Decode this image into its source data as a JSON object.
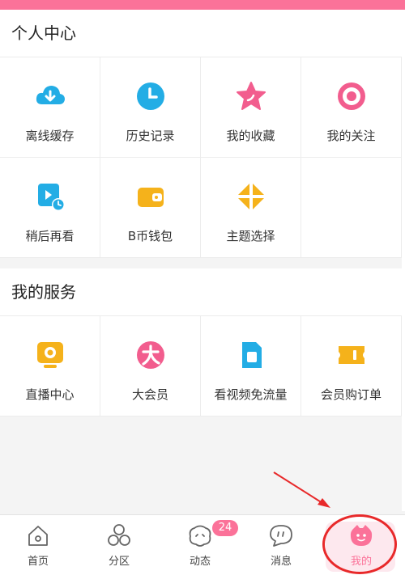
{
  "colors": {
    "brand_pink": "#fb7299",
    "annotation_red": "#e8292a"
  },
  "sections": {
    "personal": {
      "title": "个人中心",
      "items": [
        {
          "label": "离线缓存",
          "icon": "cloud-download-icon"
        },
        {
          "label": "历史记录",
          "icon": "clock-icon"
        },
        {
          "label": "我的收藏",
          "icon": "star-icon"
        },
        {
          "label": "我的关注",
          "icon": "target-icon"
        },
        {
          "label": "稍后再看",
          "icon": "watch-later-icon"
        },
        {
          "label": "B币钱包",
          "icon": "wallet-icon"
        },
        {
          "label": "主题选择",
          "icon": "theme-icon"
        }
      ]
    },
    "services": {
      "title": "我的服务",
      "items": [
        {
          "label": "直播中心",
          "icon": "live-tv-icon"
        },
        {
          "label": "大会员",
          "icon": "vip-icon"
        },
        {
          "label": "看视频免流量",
          "icon": "sim-card-icon"
        },
        {
          "label": "会员购订单",
          "icon": "ticket-icon"
        }
      ]
    }
  },
  "bottom_nav": {
    "tabs": [
      {
        "label": "首页",
        "icon": "home-icon"
      },
      {
        "label": "分区",
        "icon": "category-icon"
      },
      {
        "label": "动态",
        "icon": "dynamic-icon",
        "badge": "24"
      },
      {
        "label": "消息",
        "icon": "message-icon"
      },
      {
        "label": "我的",
        "icon": "profile-icon",
        "active": true
      }
    ]
  }
}
